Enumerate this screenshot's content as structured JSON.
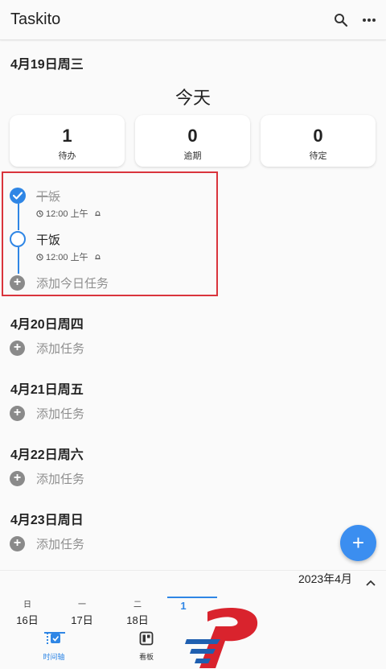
{
  "app": {
    "title": "Taskito"
  },
  "today_section": {
    "date_header": "4月19日周三",
    "title": "今天",
    "stats": [
      {
        "value": "1",
        "label": "待办"
      },
      {
        "value": "0",
        "label": "逾期"
      },
      {
        "value": "0",
        "label": "待定"
      }
    ],
    "tasks": [
      {
        "title": "干饭",
        "time": "12:00 上午",
        "done": true
      },
      {
        "title": "干饭",
        "time": "12:00 上午",
        "done": false
      }
    ],
    "add_label": "添加今日任务"
  },
  "days": [
    {
      "date_header": "4月20日周四",
      "add_label": "添加任务"
    },
    {
      "date_header": "4月21日周五",
      "add_label": "添加任务"
    },
    {
      "date_header": "4月22日周六",
      "add_label": "添加任务"
    },
    {
      "date_header": "4月23日周日",
      "add_label": "添加任务"
    }
  ],
  "calendar": {
    "month_label": "2023年4月",
    "week_days": [
      {
        "weekday": "日",
        "day": "16日"
      },
      {
        "weekday": "一",
        "day": "17日"
      },
      {
        "weekday": "二",
        "day": "18日"
      },
      {
        "weekday": "",
        "day": "1"
      }
    ]
  },
  "bottom_nav": [
    {
      "label": "时间轴",
      "active": true
    },
    {
      "label": "看板",
      "active": false
    }
  ],
  "colors": {
    "accent": "#2f86e5",
    "fab": "#3b8ef0",
    "highlight_border": "#d9343c",
    "muted": "#8f8f8f"
  }
}
